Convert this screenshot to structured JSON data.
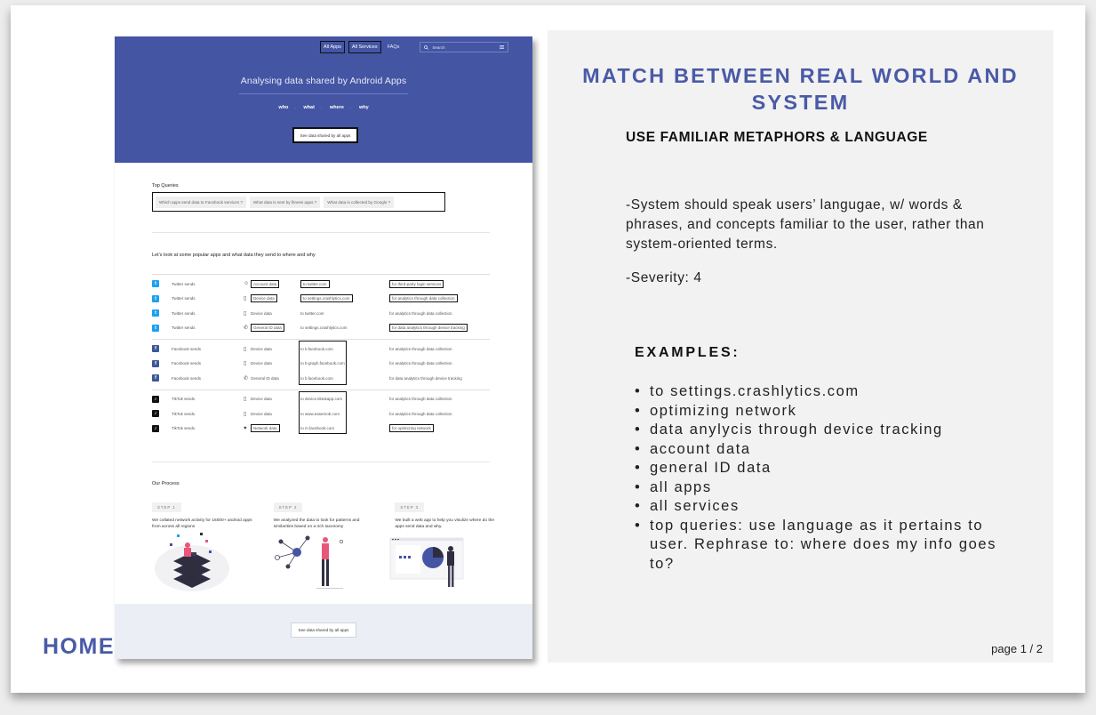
{
  "slide": {
    "home_label": "HOME",
    "panel_title": "MATCH BETWEEN REAL WORLD AND SYSTEM",
    "panel_subtitle": "USE FAMILIAR METAPHORS & LANGUAGE",
    "panel_body": "-System should speak users’ langugae, w/ words & phrases, and concepts familiar to the user, rather than system-oriented terms.",
    "severity": "-Severity: 4",
    "examples_heading": "EXAMPLES:",
    "examples": [
      "to settings.crashlytics.com",
      "optimizing network",
      "data anylycis through device tracking",
      "account data",
      "general ID data",
      "all apps",
      "all services",
      "top queries: use language as it pertains to user. Rephrase to: where does my info goes to?"
    ],
    "page_number": "page 1 / 2"
  },
  "mock": {
    "nav": {
      "all_apps": "All Apps",
      "all_services": "All Services",
      "faqs": "FAQs",
      "search_placeholder": "Search",
      "search_icon": "search-icon",
      "menu_icon": "hamburger-icon"
    },
    "hero": {
      "title": "Analysing data shared by Android Apps",
      "words": [
        "who",
        "what",
        "where",
        "why"
      ],
      "cta": "See data shared by all apps",
      "color": "#4455a4"
    },
    "top_queries": {
      "heading": "Top Queries",
      "items": [
        "Which apps send data to Facebook services ?",
        "What data is sent by fitness apps ?",
        "What data is collected by Google ?"
      ]
    },
    "popular_heading": "Let’s look at some popular apps and what data they send to where and why",
    "groups": [
      {
        "brand": "twitter",
        "rows": [
          {
            "sender": "Twitter sends",
            "icon": "user-circle-icon",
            "data": "Account data",
            "dest": "to twitter.com",
            "purpose": "for third-party login services"
          },
          {
            "sender": "Twitter sends",
            "icon": "phone-icon",
            "data": "Device data",
            "dest": "to settings.crashlytics.com",
            "purpose": "for analytics through data collection"
          },
          {
            "sender": "Twitter sends",
            "icon": "phone-icon",
            "data": "Device data",
            "dest": "to twitter.com",
            "purpose": "for analytics through data collection"
          },
          {
            "sender": "Twitter sends",
            "icon": "handset-icon",
            "data": "General ID data",
            "dest": "to settings.crashlytics.com",
            "purpose": "for data analytics through device tracking"
          }
        ]
      },
      {
        "brand": "facebook",
        "rows": [
          {
            "sender": "Facebook sends",
            "icon": "phone-icon",
            "data": "Device data",
            "dest": "to b.facebook.com",
            "purpose": "for analytics through data collection"
          },
          {
            "sender": "Facebook sends",
            "icon": "phone-icon",
            "data": "Device data",
            "dest": "to b-graph.facebook.com",
            "purpose": "for analytics through data collection"
          },
          {
            "sender": "Facebook sends",
            "icon": "handset-icon",
            "data": "General ID data",
            "dest": "to b.facebook.com",
            "purpose": "for data analytics through device tracking"
          }
        ]
      },
      {
        "brand": "tiktok",
        "rows": [
          {
            "sender": "TikTok sends",
            "icon": "phone-icon",
            "data": "Device data",
            "dest": "to device.tiktokapp.com",
            "purpose": "for analytics through data collection"
          },
          {
            "sender": "TikTok sends",
            "icon": "phone-icon",
            "data": "Device data",
            "dest": "to www.easemob.com",
            "purpose": "for analytics through data collection"
          },
          {
            "sender": "TikTok sends",
            "icon": "wifi-icon",
            "data": "Network data",
            "dest": "to m.facebook.com",
            "purpose": "for optimizing network"
          }
        ]
      }
    ],
    "process": {
      "heading": "Our Process",
      "steps": [
        {
          "tag": "STEP 1",
          "text": "We collated network activity for 16000+ android apps from across all regions"
        },
        {
          "tag": "STEP 2",
          "text": "We analyzed the data to look for patterns and similarities based on a rich taxonomy"
        },
        {
          "tag": "STEP 3",
          "text": "We built a web app to help you visulize where do the apps send data and why."
        }
      ]
    },
    "footer_cta": "See data shared by all apps"
  }
}
